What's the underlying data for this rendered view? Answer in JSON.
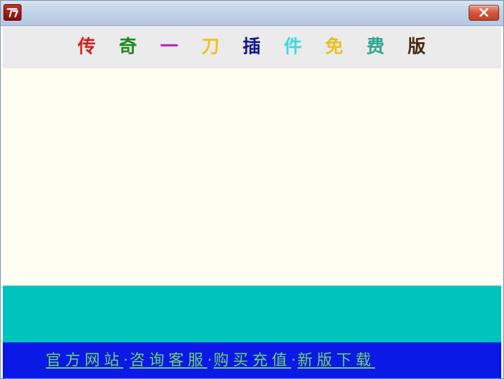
{
  "title_chars": [
    {
      "char": "传",
      "color": "#d02020"
    },
    {
      "char": "奇",
      "color": "#1e8a1e"
    },
    {
      "char": "一",
      "color": "#c020c8"
    },
    {
      "char": "刀",
      "color": "#f0c020"
    },
    {
      "char": "插",
      "color": "#101890"
    },
    {
      "char": "件",
      "color": "#40d8e0"
    },
    {
      "char": "免",
      "color": "#e8c020"
    },
    {
      "char": "费",
      "color": "#30a890"
    },
    {
      "char": "版",
      "color": "#4a2810"
    }
  ],
  "links": [
    {
      "label": "官方网站"
    },
    {
      "label": "咨询客服"
    },
    {
      "label": "购买充值"
    },
    {
      "label": "新版下载"
    }
  ],
  "separator": "·",
  "colors": {
    "header_bg": "#ebebeb",
    "content_bg": "#fefef2",
    "teal_bar": "#00c3be",
    "link_bar": "#0a19e6",
    "link_text": "#6ed36e"
  },
  "icons": {
    "app": "app-logo-icon",
    "close": "close-icon"
  }
}
